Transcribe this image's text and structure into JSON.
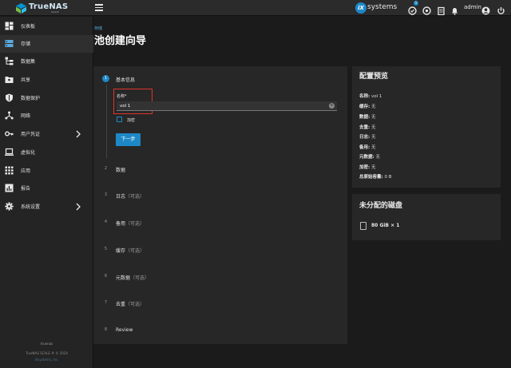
{
  "app": {
    "brand": "TrueNAS",
    "brand_sub": "SCALE",
    "vendor": "systems",
    "vendor_mark": "iX",
    "user": "admin",
    "notification_count": "1"
  },
  "sidebar": {
    "items": [
      {
        "label": "仪表板",
        "icon": "dashboard-icon"
      },
      {
        "label": "存储",
        "icon": "storage-icon"
      },
      {
        "label": "数据集",
        "icon": "datasets-icon"
      },
      {
        "label": "共享",
        "icon": "shares-icon"
      },
      {
        "label": "数据保护",
        "icon": "shield-icon"
      },
      {
        "label": "网络",
        "icon": "network-icon"
      },
      {
        "label": "用户凭证",
        "icon": "key-icon"
      },
      {
        "label": "虚拟化",
        "icon": "laptop-icon"
      },
      {
        "label": "应用",
        "icon": "apps-icon"
      },
      {
        "label": "报告",
        "icon": "reports-icon"
      },
      {
        "label": "系统设置",
        "icon": "gear-icon"
      }
    ],
    "hostname": "truenas",
    "version": "TrueNAS SCALE ® © 2024",
    "company": "iXsystems, Inc."
  },
  "page": {
    "breadcrumb": "存储",
    "title": "池创建向导"
  },
  "wizard": {
    "steps": [
      {
        "num": "1",
        "title": "基本信息",
        "optional": ""
      },
      {
        "num": "2",
        "title": "数据",
        "optional": ""
      },
      {
        "num": "3",
        "title": "日志",
        "optional": "（可选）"
      },
      {
        "num": "4",
        "title": "备用",
        "optional": "（可选）"
      },
      {
        "num": "5",
        "title": "缓存",
        "optional": "（可选）"
      },
      {
        "num": "6",
        "title": "元数据",
        "optional": "（可选）"
      },
      {
        "num": "7",
        "title": "去重",
        "optional": "（可选）"
      },
      {
        "num": "8",
        "title": "Review",
        "optional": ""
      }
    ],
    "name_label": "名称",
    "name_required": "*",
    "name_value": "vol 1",
    "encrypt_label": "加密",
    "next_label": "下一步"
  },
  "preview": {
    "title": "配置预览",
    "rows": [
      {
        "key": "名称:",
        "value": "vol 1"
      },
      {
        "key": "缓存:",
        "value": "无"
      },
      {
        "key": "数据:",
        "value": "无"
      },
      {
        "key": "去重:",
        "value": "无"
      },
      {
        "key": "日志:",
        "value": "无"
      },
      {
        "key": "备用:",
        "value": "无"
      },
      {
        "key": "元数据:",
        "value": "无"
      },
      {
        "key": "加密:",
        "value": "无"
      },
      {
        "key": "总原始容量:",
        "value": "0 B"
      }
    ]
  },
  "unassigned": {
    "title": "未分配的磁盘",
    "disk": "80 GiB × 1"
  },
  "colors": {
    "accent": "#1e88c7",
    "highlight": "#e0342a",
    "panel": "#272727",
    "background": "#1b1b1b"
  }
}
